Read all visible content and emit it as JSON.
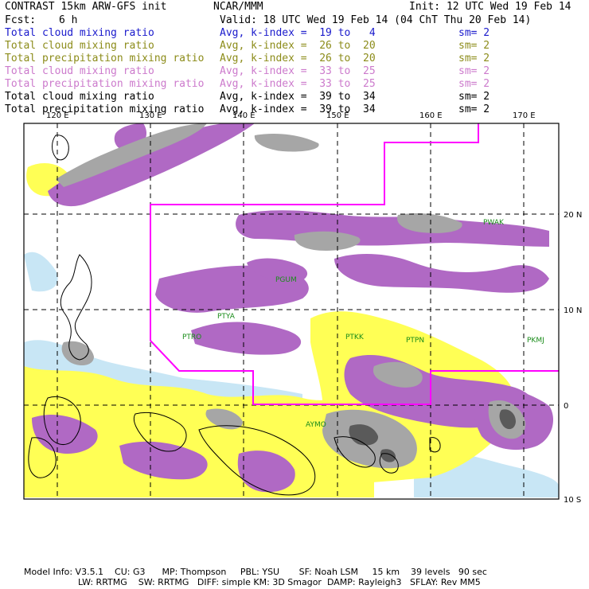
{
  "header": {
    "title": "CONTRAST 15km ARW-GFS init",
    "org": "NCAR/MMM",
    "init": "Init: 12 UTC Wed 19 Feb 14",
    "fcst_label": "Fcst:",
    "fcst_value": "6 h",
    "valid": "Valid: 18 UTC Wed 19 Feb 14 (04 ChT Thu 20 Feb 14)"
  },
  "legend": [
    {
      "name": "Total cloud mixing ratio",
      "avg": "Avg, k-index =  19 to   4",
      "sm": "sm= 2",
      "color": "#1a1acc"
    },
    {
      "name": "Total cloud mixing ratio",
      "avg": "Avg, k-index =  26 to  20",
      "sm": "sm= 2",
      "color": "#8c8c1a"
    },
    {
      "name": "Total precipitation mixing ratio",
      "avg": "Avg, k-index =  26 to  20",
      "sm": "sm= 2",
      "color": "#8c8c1a"
    },
    {
      "name": "Total cloud mixing ratio",
      "avg": "Avg, k-index =  33 to  25",
      "sm": "sm= 2",
      "color": "#cc7acc"
    },
    {
      "name": "Total precipitation mixing ratio",
      "avg": "Avg, k-index =  33 to  25",
      "sm": "sm= 2",
      "color": "#cc7acc"
    },
    {
      "name": "Total cloud mixing ratio",
      "avg": "Avg, k-index =  39 to  34",
      "sm": "sm= 2",
      "color": "#000000"
    },
    {
      "name": "Total precipitation mixing ratio",
      "avg": "Avg, k-index =  39 to  34",
      "sm": "sm= 2",
      "color": "#000000"
    }
  ],
  "map": {
    "lon_labels": [
      "120 E",
      "130 E",
      "140 E",
      "150 E",
      "160 E",
      "170 E"
    ],
    "lat_labels": [
      "20 N",
      "10 N",
      "0",
      "10 S"
    ],
    "stations": [
      "PGUM",
      "PTYA",
      "PTRO",
      "PTKK",
      "PTPN",
      "PKMJ",
      "PWAK",
      "AYMO"
    ],
    "colors": {
      "purple": "#b069c4",
      "gray": "#a6a6a6",
      "yellow": "#ffff55",
      "light_blue": "#c8e6f5",
      "boundary": "#ff00ff",
      "station": "#1a8c1a"
    }
  },
  "footer": {
    "line1": "Model Info: V3.5.1    CU: G3      MP: Thompson     PBL: YSU       SF: Noah LSM     15 km    39 levels   90 sec",
    "line2": "LW: RRTMG    SW: RRTMG   DIFF: simple KM: 3D Smagor  DAMP: Rayleigh3   SFLAY: Rev MM5"
  }
}
